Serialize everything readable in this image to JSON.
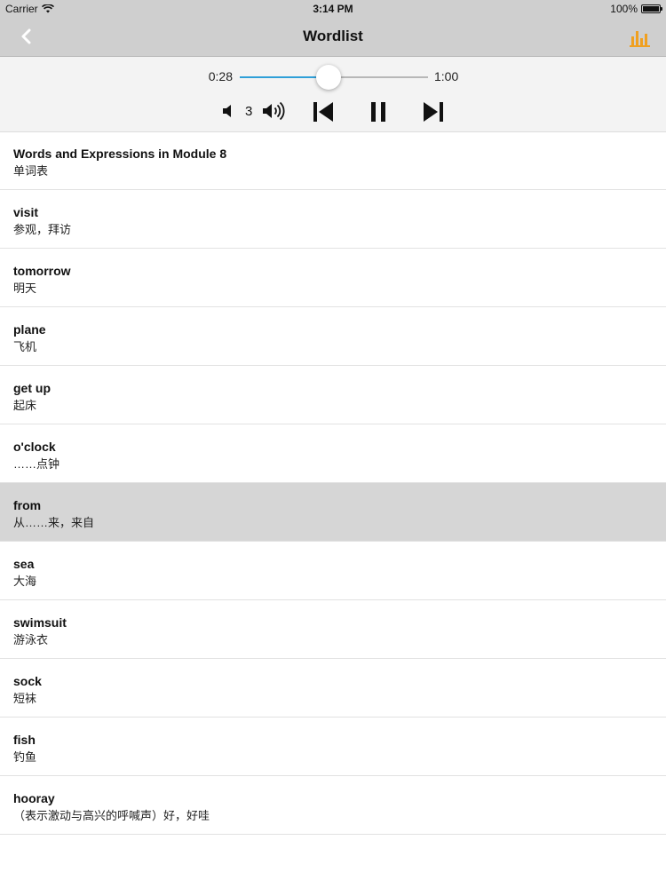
{
  "status_bar": {
    "carrier": "Carrier",
    "time": "3:14 PM",
    "battery": "100%"
  },
  "nav": {
    "title": "Wordlist",
    "back_icon": "chevron-left-icon",
    "stats_icon": "bar-chart-icon",
    "accent_color": "#f0a020"
  },
  "player": {
    "current_time": "0:28",
    "total_time": "1:00",
    "progress": 0.47,
    "volume_level": "3",
    "slider_color": "#2f9fd8"
  },
  "words": [
    {
      "en": "Words and Expressions in Module 8",
      "cn": "单词表"
    },
    {
      "en": "visit",
      "cn": "参观，拜访"
    },
    {
      "en": "tomorrow",
      "cn": "明天"
    },
    {
      "en": "plane",
      "cn": "飞机"
    },
    {
      "en": "get up",
      "cn": "起床"
    },
    {
      "en": "o'clock",
      "cn": "……点钟"
    },
    {
      "en": "from",
      "cn": "从……来，来自"
    },
    {
      "en": "sea",
      "cn": "大海"
    },
    {
      "en": "swimsuit",
      "cn": "游泳衣"
    },
    {
      "en": "sock",
      "cn": "短袜"
    },
    {
      "en": "fish",
      "cn": "钓鱼"
    },
    {
      "en": "hooray",
      "cn": "（表示激动与高兴的呼喊声）好，好哇"
    }
  ],
  "selected_index": 6
}
